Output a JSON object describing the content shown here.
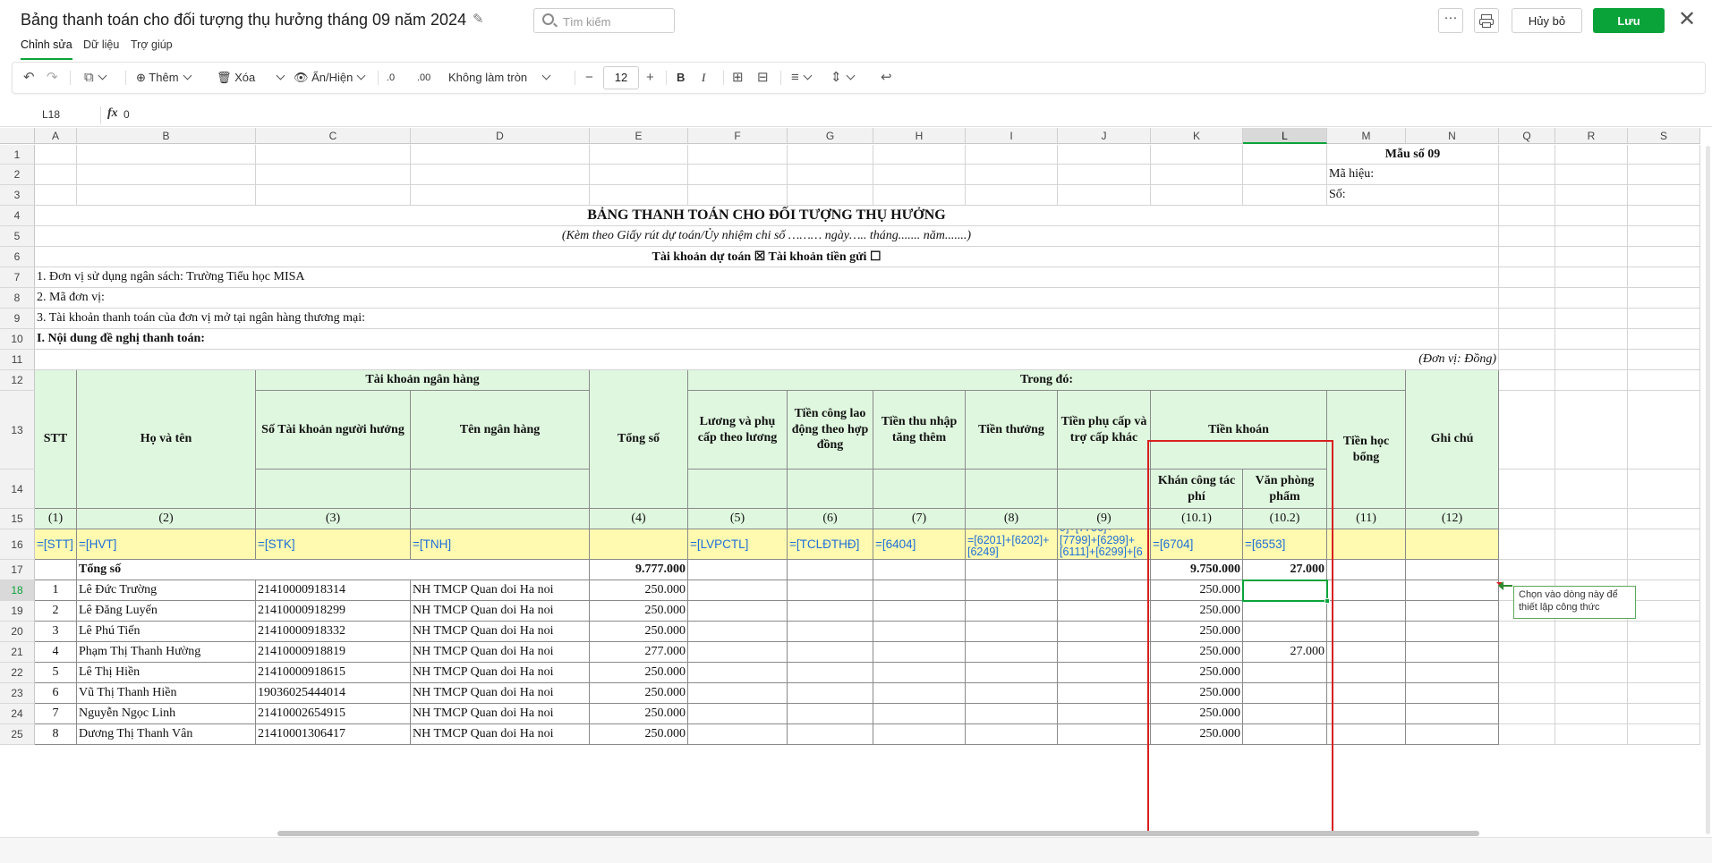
{
  "header": {
    "title": "Bảng thanh toán cho đối tượng thụ hưởng tháng 09 năm 2024",
    "search_placeholder": "Tìm kiếm",
    "more_label": "···",
    "cancel_label": "Hủy bỏ",
    "save_label": "Lưu",
    "close_label": "✕"
  },
  "menu": {
    "items": [
      "Chỉnh sửa",
      "Dữ liệu",
      "Trợ giúp"
    ]
  },
  "toolbar": {
    "add_label": "Thêm",
    "delete_label": "Xóa",
    "showhide_label": "Ẩn/Hiện",
    "rounding_label": "Không làm tròn",
    "font_size": "12"
  },
  "formula_bar": {
    "cell_ref": "L18",
    "fx_label": "fx",
    "value": "0"
  },
  "columns": [
    "A",
    "B",
    "C",
    "D",
    "E",
    "F",
    "G",
    "H",
    "I",
    "J",
    "K",
    "L",
    "M",
    "N",
    "Q",
    "R",
    "S"
  ],
  "rows": [
    "1",
    "2",
    "3",
    "4",
    "5",
    "6",
    "7",
    "8",
    "9",
    "10",
    "11",
    "12",
    "13",
    "14",
    "15",
    "16",
    "17",
    "18",
    "19",
    "20",
    "21",
    "22",
    "23",
    "24",
    "25"
  ],
  "sheet": {
    "form_no": "Mẫu số 09",
    "ma_hieu": "Mã hiệu:",
    "so": "Số:",
    "title": "BẢNG THANH TOÁN CHO ĐỐI TƯỢNG THỤ HƯỞNG",
    "subtitle": "(Kèm theo Giấy rút dự toán/Ủy nhiệm chi số ……… ngày….. tháng....... năm.......)",
    "accounts": "Tài khoản dự toán ☒    Tài khoản tiền gửi ☐",
    "line1": "1. Đơn vị sử dụng ngân sách: Trường Tiểu học MISA",
    "line2": "2. Mã đơn vị:",
    "line3": "3. Tài khoản thanh toán của đơn vị mở tại ngân hàng thương mại:",
    "section": "I. Nội dung đề nghị thanh toán:",
    "unit": "(Đơn vị: Đồng)",
    "hdr_stt": "STT",
    "hdr_name": "Họ và tên",
    "hdr_bank": "Tài khoản ngân hàng",
    "hdr_acct": "Số Tài khoản người hưởng",
    "hdr_bankname": "Tên ngân hàng",
    "hdr_total": "Tổng số",
    "hdr_trong_do": "Trong đó:",
    "hdr_f": "Lương và phụ cấp theo lương",
    "hdr_g": "Tiền công lao động theo hợp đồng",
    "hdr_h": "Tiền thu nhập tăng thêm",
    "hdr_i": "Tiền thưởng",
    "hdr_j": "Tiền phụ cấp và trợ cấp khác",
    "hdr_k": "Tiền khoán",
    "hdr_k1": "Khán công tác phí",
    "hdr_l1": "Văn phòng phẩm",
    "hdr_m": "Tiền học bổng",
    "hdr_n": "Ghi chú",
    "idx": [
      "(1)",
      "(2)",
      "(3)",
      "",
      "(4)",
      "(5)",
      "(6)",
      "(7)",
      "(8)",
      "(9)",
      "(10.1)",
      "(10.2)",
      "(11)",
      "(12)"
    ],
    "formulas": [
      "=[STT]",
      "=[HVT]",
      "=[STK]",
      "=[TNH]",
      "",
      "=[LVPCTL]",
      "=[TCLĐTHĐ]",
      "=[6404]",
      "=[6201]+[6202]+[6249]",
      "9]+[7756]+[7799]+[6299]+[6111]+[6299]+[6",
      "=[6704]",
      "=[6553]"
    ],
    "total_label": "Tổng số",
    "total_e": "9.777.000",
    "total_k": "9.750.000",
    "total_l": "27.000",
    "data": [
      {
        "stt": "1",
        "name": "Lê Đức Trường",
        "acct": "21410000918314",
        "bank": "NH TMCP Quan doi Ha noi",
        "total": "250.000",
        "k": "250.000",
        "l": ""
      },
      {
        "stt": "2",
        "name": "Lê Đăng Luyến",
        "acct": "21410000918299",
        "bank": "NH TMCP Quan doi Ha noi",
        "total": "250.000",
        "k": "250.000",
        "l": ""
      },
      {
        "stt": "3",
        "name": "Lê Phú Tiến",
        "acct": "21410000918332",
        "bank": "NH TMCP Quan doi Ha noi",
        "total": "250.000",
        "k": "250.000",
        "l": ""
      },
      {
        "stt": "4",
        "name": "Phạm Thị Thanh  Hường",
        "acct": "21410000918819",
        "bank": "NH TMCP Quan doi Ha noi",
        "total": "277.000",
        "k": "250.000",
        "l": "27.000"
      },
      {
        "stt": "5",
        "name": "Lê Thị Hiền",
        "acct": "21410000918615",
        "bank": "NH TMCP Quan doi Ha noi",
        "total": "250.000",
        "k": "250.000",
        "l": ""
      },
      {
        "stt": "6",
        "name": "Vũ Thị Thanh Hiền",
        "acct": "19036025444014",
        "bank": "NH TMCP Quan doi Ha noi",
        "total": "250.000",
        "k": "250.000",
        "l": ""
      },
      {
        "stt": "7",
        "name": "Nguyễn Ngọc Linh",
        "acct": "21410002654915",
        "bank": "NH TMCP Quan doi Ha noi",
        "total": "250.000",
        "k": "250.000",
        "l": ""
      },
      {
        "stt": "8",
        "name": "Dương Thị Thanh Vân",
        "acct": "21410001306417",
        "bank": "NH TMCP Quan doi Ha noi",
        "total": "250.000",
        "k": "250.000",
        "l": ""
      }
    ]
  },
  "tooltip": "Chọn vào dòng này để thiết lập công thức",
  "colors": {
    "accent": "#0aa33a",
    "header_fill": "#dff7df",
    "formula_fill": "#fffab0",
    "highlight_border": "#d82020",
    "formula_text": "#1e6fd6"
  }
}
